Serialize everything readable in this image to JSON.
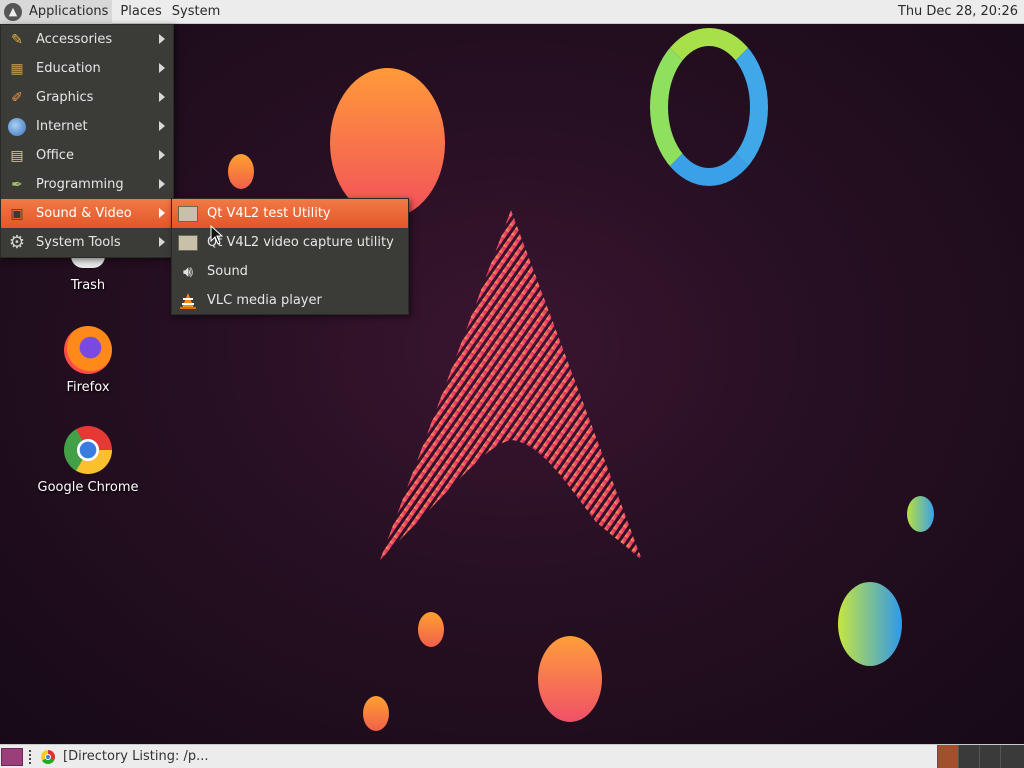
{
  "top_panel": {
    "menus": [
      "Applications",
      "Places",
      "System"
    ],
    "clock": "Thu Dec 28, 20:26"
  },
  "apps_menu": {
    "items": [
      {
        "label": "Accessories",
        "icon": "accessories-icon"
      },
      {
        "label": "Education",
        "icon": "education-icon"
      },
      {
        "label": "Graphics",
        "icon": "graphics-icon"
      },
      {
        "label": "Internet",
        "icon": "internet-icon"
      },
      {
        "label": "Office",
        "icon": "office-icon"
      },
      {
        "label": "Programming",
        "icon": "programming-icon"
      },
      {
        "label": "Sound & Video",
        "icon": "sound-video-icon",
        "highlighted": true
      },
      {
        "label": "System Tools",
        "icon": "gear-icon"
      }
    ]
  },
  "sub_menu": {
    "items": [
      {
        "label": "Qt V4L2 test Utility",
        "icon": "qt-v4l2-icon",
        "highlighted": true
      },
      {
        "label": "Qt V4L2 video capture utility",
        "icon": "qt-v4l2-icon"
      },
      {
        "label": "Sound",
        "icon": "speaker-icon"
      },
      {
        "label": "VLC media player",
        "icon": "vlc-cone-icon"
      }
    ]
  },
  "desktop_icons": [
    {
      "label": "Trash",
      "icon": "trash-icon"
    },
    {
      "label": "Firefox",
      "icon": "firefox-icon"
    },
    {
      "label": "Google Chrome",
      "icon": "chrome-icon"
    }
  ],
  "bottom_panel": {
    "task_label": "[Directory Listing: /p..."
  },
  "colors": {
    "menu_bg": "#3b3b38",
    "highlight": "#e9643a",
    "panel_bg": "#ececec"
  }
}
